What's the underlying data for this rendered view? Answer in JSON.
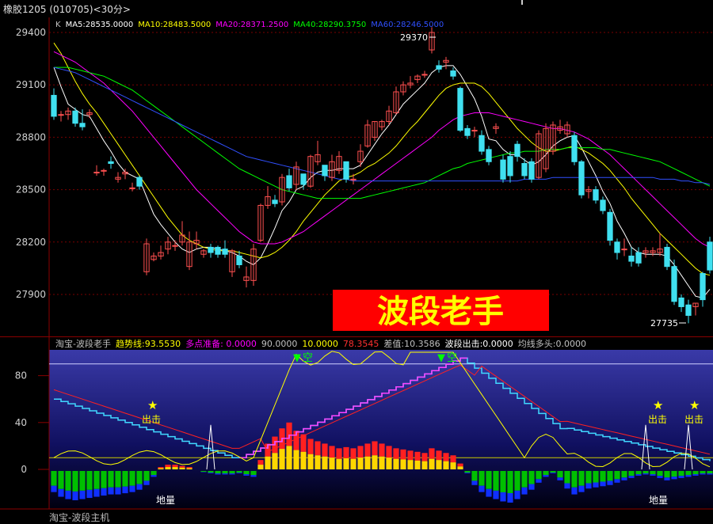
{
  "window": {
    "title": "橡胶1205 (010705)<30分>"
  },
  "price_panel": {
    "ma_legend": [
      {
        "label": "K",
        "color": "#c0c0c0"
      },
      {
        "label": "MA5:28535.0000",
        "color": "#ffffff"
      },
      {
        "label": "MA10:28483.5000",
        "color": "#ffff00"
      },
      {
        "label": "MA20:28371.2500",
        "color": "#ff00ff"
      },
      {
        "label": "MA40:28290.3750",
        "color": "#00ff00"
      },
      {
        "label": "MA60:28246.5000",
        "color": "#3050ff"
      }
    ],
    "y_ticks": [
      "29400",
      "29100",
      "28800",
      "28500",
      "28200",
      "27900"
    ],
    "high_label": "29370",
    "low_label": "27735",
    "banner_text": "波段老手"
  },
  "indicator_panel": {
    "legend": [
      {
        "label": "淘宝-波段老手",
        "color": "#c0c0c0"
      },
      {
        "label": "趋势线:93.5530",
        "color": "#ffff00"
      },
      {
        "label": "多点准备: 0.0000",
        "color": "#ff00ff"
      },
      {
        "label": "90.0000",
        "color": "#c0c0c0"
      },
      {
        "label": "10.0000",
        "color": "#ffff00"
      },
      {
        "label": "78.3545",
        "color": "#ff3030"
      },
      {
        "label": "差值:10.3586",
        "color": "#c0c0c0"
      },
      {
        "label": "波段出击:0.0000",
        "color": "#ffffff"
      },
      {
        "label": "均线多头:0.0000",
        "color": "#c0c0c0"
      }
    ],
    "y_ticks": [
      "80",
      "40",
      "0"
    ],
    "kong_label": "空",
    "chuji_label": "出击",
    "diliang_label": "地量",
    "star_glyph": "★",
    "triangle_glyph": "▼"
  },
  "footer": {
    "text": "淘宝-波段主机"
  },
  "chart_data": {
    "type": "candlestick",
    "y_range": [
      27700,
      29500
    ],
    "open": [
      29040,
      28930,
      28930,
      28950,
      28880,
      28930,
      28600,
      28610,
      28660,
      28560,
      28590,
      28510,
      28570,
      28030,
      28100,
      28120,
      28160,
      28180,
      28200,
      28060,
      28190,
      28130,
      28170,
      28170,
      28160,
      28030,
      28120,
      27980,
      27980,
      28210,
      28410,
      28440,
      28430,
      28580,
      28530,
      28590,
      28520,
      28660,
      28640,
      28570,
      28610,
      28660,
      28560,
      28660,
      28750,
      28800,
      28860,
      28890,
      28940,
      29060,
      29100,
      29130,
      29160,
      29300,
      29210,
      29230,
      29180,
      29080,
      28850,
      28840,
      28810,
      28730,
      28850,
      28670,
      28690,
      28760,
      28650,
      28660,
      28570,
      28620,
      28720,
      28840,
      28820,
      28810,
      28660,
      28490,
      28500,
      28440,
      28370,
      28200,
      28160,
      28120,
      28140,
      28140,
      28140,
      28140,
      28170,
      28060,
      27880,
      27840,
      27830,
      28020,
      28200
    ],
    "close": [
      28920,
      28930,
      28950,
      28880,
      28860,
      28940,
      28600,
      28610,
      28650,
      28570,
      28600,
      28510,
      28520,
      28190,
      28120,
      28140,
      28200,
      28180,
      28240,
      28200,
      28210,
      28150,
      28140,
      28130,
      28130,
      28150,
      28070,
      28000,
      28160,
      28410,
      28460,
      28420,
      28570,
      28510,
      28630,
      28530,
      28690,
      28700,
      28580,
      28660,
      28690,
      28560,
      28560,
      28720,
      28870,
      28890,
      28890,
      28950,
      29060,
      29100,
      29110,
      29150,
      29160,
      29400,
      29190,
      29240,
      29150,
      28840,
      28810,
      28840,
      28720,
      28660,
      28860,
      28560,
      28580,
      28690,
      28580,
      28560,
      28820,
      28850,
      28870,
      28860,
      28870,
      28660,
      28470,
      28500,
      28440,
      28380,
      28210,
      28140,
      28160,
      28090,
      28080,
      28150,
      28150,
      28160,
      28060,
      27860,
      27830,
      27780,
      27850,
      27870,
      28040
    ],
    "high": [
      29080,
      28950,
      28970,
      28970,
      28960,
      28960,
      28640,
      28620,
      28690,
      28600,
      28620,
      28540,
      28580,
      28220,
      28140,
      28180,
      28230,
      28210,
      28320,
      28260,
      28260,
      28160,
      28190,
      28180,
      28210,
      28160,
      28150,
      28060,
      28190,
      28420,
      28520,
      28470,
      28590,
      28620,
      28660,
      28560,
      28700,
      28780,
      28600,
      28700,
      28720,
      28660,
      28590,
      28760,
      28900,
      28890,
      28900,
      28980,
      29090,
      29120,
      29150,
      29160,
      29180,
      29430,
      29240,
      29260,
      29200,
      29090,
      28870,
      28860,
      28840,
      28750,
      28880,
      28700,
      28720,
      28780,
      28680,
      28680,
      28840,
      28880,
      28890,
      28900,
      28890,
      28830,
      28670,
      28520,
      28520,
      28460,
      28390,
      28220,
      28220,
      28170,
      28170,
      28170,
      28170,
      28250,
      28190,
      28100,
      27900,
      27870,
      27850,
      28030,
      28230
    ],
    "low": [
      28900,
      28890,
      28900,
      28860,
      28840,
      28910,
      28580,
      28580,
      28620,
      28540,
      28560,
      28490,
      28500,
      28010,
      28090,
      28100,
      28130,
      28150,
      28180,
      28040,
      28160,
      28110,
      28110,
      28110,
      28110,
      28000,
      28050,
      27940,
      27950,
      28200,
      28390,
      28400,
      28410,
      28490,
      28500,
      28500,
      28510,
      28640,
      28550,
      28550,
      28590,
      28540,
      28530,
      28630,
      28740,
      28780,
      28840,
      28870,
      28930,
      29040,
      29080,
      29110,
      29140,
      29280,
      29170,
      29190,
      29130,
      28830,
      28790,
      28800,
      28700,
      28640,
      28820,
      28540,
      28540,
      28660,
      28560,
      28540,
      28560,
      28600,
      28700,
      28820,
      28800,
      28640,
      28450,
      28450,
      28420,
      28360,
      28180,
      28100,
      28120,
      28060,
      28060,
      28110,
      28120,
      28120,
      28040,
      27840,
      27800,
      27735,
      27780,
      27830,
      28020
    ],
    "ma": [
      {
        "name": "MA5",
        "color": "#ffffff",
        "values": [
          29200,
          29090,
          28990,
          28960,
          28930,
          28920,
          28850,
          28780,
          28720,
          28650,
          28600,
          28580,
          28560,
          28460,
          28360,
          28300,
          28250,
          28200,
          28160,
          28140,
          28160,
          28170,
          28170,
          28160,
          28150,
          28140,
          28120,
          28090,
          28070,
          28110,
          28190,
          28280,
          28380,
          28430,
          28500,
          28520,
          28570,
          28600,
          28610,
          28610,
          28620,
          28620,
          28620,
          28640,
          28700,
          28760,
          28820,
          28870,
          28930,
          28990,
          29030,
          29070,
          29110,
          29170,
          29200,
          29210,
          29210,
          29160,
          29090,
          29020,
          28920,
          28790,
          28780,
          28730,
          28700,
          28700,
          28670,
          28640,
          28660,
          28700,
          28750,
          28780,
          28800,
          28810,
          28740,
          28660,
          28580,
          28490,
          28420,
          28320,
          28250,
          28170,
          28140,
          28130,
          28130,
          28130,
          28120,
          28070,
          28010,
          27950,
          27890,
          27880,
          27930
        ]
      },
      {
        "name": "MA10",
        "color": "#ffff00",
        "values": [
          29340,
          29280,
          29200,
          29120,
          29050,
          28990,
          28940,
          28880,
          28820,
          28760,
          28700,
          28640,
          28580,
          28520,
          28460,
          28400,
          28340,
          28290,
          28240,
          28210,
          28190,
          28170,
          28160,
          28150,
          28150,
          28150,
          28140,
          28130,
          28120,
          28110,
          28120,
          28140,
          28170,
          28210,
          28260,
          28320,
          28370,
          28420,
          28470,
          28510,
          28550,
          28570,
          28580,
          28600,
          28630,
          28650,
          28680,
          28710,
          28750,
          28800,
          28850,
          28890,
          28940,
          28990,
          29040,
          29080,
          29100,
          29110,
          29110,
          29110,
          29090,
          29050,
          29000,
          28950,
          28900,
          28850,
          28810,
          28770,
          28740,
          28720,
          28720,
          28730,
          28740,
          28750,
          28730,
          28710,
          28680,
          28650,
          28610,
          28560,
          28510,
          28450,
          28400,
          28350,
          28300,
          28250,
          28210,
          28170,
          28130,
          28090,
          28050,
          28020,
          28010
        ]
      },
      {
        "name": "MA20",
        "color": "#ff00ff",
        "values": [
          29290,
          29270,
          29250,
          29230,
          29200,
          29170,
          29140,
          29110,
          29070,
          29030,
          28990,
          28950,
          28900,
          28850,
          28800,
          28750,
          28700,
          28650,
          28600,
          28550,
          28500,
          28460,
          28420,
          28380,
          28340,
          28300,
          28260,
          28230,
          28200,
          28190,
          28190,
          28190,
          28200,
          28220,
          28240,
          28260,
          28290,
          28320,
          28350,
          28380,
          28410,
          28440,
          28470,
          28500,
          28530,
          28560,
          28590,
          28620,
          28650,
          28680,
          28710,
          28740,
          28770,
          28800,
          28840,
          28870,
          28900,
          28920,
          28930,
          28940,
          28940,
          28940,
          28930,
          28920,
          28910,
          28900,
          28890,
          28880,
          28870,
          28860,
          28850,
          28850,
          28840,
          28830,
          28810,
          28790,
          28760,
          28730,
          28700,
          28660,
          28620,
          28580,
          28540,
          28500,
          28460,
          28420,
          28380,
          28340,
          28300,
          28260,
          28220,
          28190,
          28170
        ]
      },
      {
        "name": "MA40",
        "color": "#00ff00",
        "values": [
          29200,
          29200,
          29200,
          29190,
          29180,
          29170,
          29160,
          29150,
          29130,
          29110,
          29090,
          29070,
          29040,
          29010,
          28980,
          28950,
          28920,
          28890,
          28860,
          28830,
          28800,
          28770,
          28740,
          28710,
          28680,
          28650,
          28620,
          28600,
          28580,
          28560,
          28540,
          28520,
          28500,
          28490,
          28480,
          28470,
          28460,
          28450,
          28450,
          28450,
          28450,
          28450,
          28450,
          28450,
          28460,
          28470,
          28480,
          28490,
          28500,
          28510,
          28520,
          28530,
          28540,
          28560,
          28580,
          28600,
          28620,
          28630,
          28650,
          28660,
          28670,
          28680,
          28690,
          28700,
          28710,
          28710,
          28720,
          28720,
          28720,
          28730,
          28730,
          28730,
          28740,
          28740,
          28740,
          28740,
          28740,
          28730,
          28730,
          28720,
          28710,
          28700,
          28690,
          28680,
          28670,
          28660,
          28640,
          28620,
          28600,
          28580,
          28560,
          28540,
          28520
        ]
      },
      {
        "name": "MA60",
        "color": "#3050ff",
        "values": [
          29200,
          29190,
          29180,
          29170,
          29150,
          29130,
          29110,
          29090,
          29070,
          29050,
          29030,
          29010,
          28990,
          28970,
          28950,
          28930,
          28910,
          28890,
          28870,
          28850,
          28830,
          28810,
          28790,
          28770,
          28750,
          28730,
          28710,
          28690,
          28680,
          28670,
          28660,
          28650,
          28640,
          28630,
          28620,
          28610,
          28600,
          28590,
          28580,
          28570,
          28560,
          28560,
          28550,
          28550,
          28550,
          28550,
          28550,
          28550,
          28550,
          28550,
          28550,
          28550,
          28550,
          28550,
          28550,
          28550,
          28550,
          28550,
          28550,
          28550,
          28550,
          28550,
          28550,
          28550,
          28550,
          28550,
          28560,
          28560,
          28560,
          28560,
          28570,
          28570,
          28570,
          28570,
          28570,
          28570,
          28570,
          28570,
          28570,
          28570,
          28570,
          28570,
          28570,
          28570,
          28570,
          28560,
          28560,
          28560,
          28550,
          28550,
          28540,
          28540,
          28530
        ]
      }
    ],
    "indicator": {
      "y_range": [
        -27,
        104
      ],
      "reference_lines": [
        90,
        10
      ],
      "bars": [
        -18,
        -22,
        -24,
        -25,
        -24,
        -23,
        -22,
        -21,
        -20,
        -20,
        -19,
        -18,
        -16,
        -12,
        -5,
        2,
        4,
        4,
        3,
        2,
        0,
        -1,
        -2,
        -3,
        -3,
        -3,
        -2,
        -4,
        -5,
        8,
        22,
        28,
        35,
        40,
        33,
        30,
        26,
        24,
        22,
        20,
        18,
        19,
        18,
        20,
        22,
        24,
        22,
        20,
        18,
        17,
        16,
        15,
        14,
        18,
        16,
        14,
        12,
        5,
        -2,
        -12,
        -18,
        -22,
        -24,
        -26,
        -27,
        -24,
        -20,
        -16,
        -10,
        -5,
        -2,
        -8,
        -15,
        -20,
        -18,
        -15,
        -14,
        -13,
        -12,
        -10,
        -8,
        -6,
        -4,
        -3,
        -4,
        -6,
        -8,
        -7,
        -6,
        -5,
        -4,
        -3,
        -3
      ]
    }
  }
}
